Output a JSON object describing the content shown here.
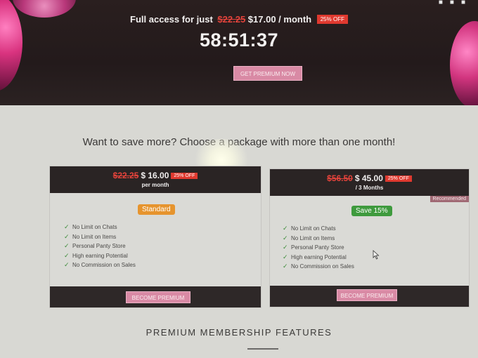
{
  "banner": {
    "offer_prefix": "Full access for just",
    "old_price": "$22.25",
    "new_price": "$17.00 / month",
    "discount_badge": "25% OFF",
    "countdown": "58:51:37",
    "cta_label": "GET PREMIUM NOW"
  },
  "headline": "Want to save more? Choose a package with more than one month!",
  "packages": [
    {
      "old_price": "$22.25",
      "new_price": "$ 16.00",
      "badge": "25% OFF",
      "period": "per month",
      "tag": "Standard",
      "tag_color": "#e6942e",
      "features": [
        "No Limit on Chats",
        "No Limit on Items",
        "Personal Panty Store",
        "High earning Potential",
        "No Commission on Sales"
      ],
      "button_label": "BECOME PREMIUM"
    },
    {
      "old_price": "$56.50",
      "new_price": "$ 45.00",
      "badge": "25% OFF",
      "period": "/ 3 Months",
      "ribbon": "Recommended",
      "tag": "Save 15%",
      "tag_color": "#3e9a3d",
      "features": [
        "No Limit on Chats",
        "No Limit on Items",
        "Personal Panty Store",
        "High earning Potential",
        "No Commission on Sales"
      ],
      "button_label": "BECOME PREMIUM"
    }
  ],
  "section_title": "PREMIUM MEMBERSHIP FEATURES",
  "colors": {
    "accent_pink": "#d98aa5",
    "strike_red": "#e4433b",
    "badge_red": "#e0392f",
    "dark_band": "#2a2424"
  },
  "icons": [
    "check-icon",
    "cursor-icon"
  ]
}
